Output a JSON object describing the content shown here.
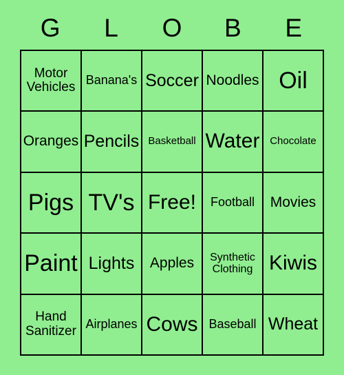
{
  "card": {
    "title": "GLOBE",
    "header_letters": [
      "G",
      "L",
      "O",
      "B",
      "E"
    ],
    "colors": {
      "background": "#90ee90",
      "cell_background": "#90ee90",
      "border": "#000000",
      "text": "#000000"
    },
    "free_space": "Free!",
    "rows": [
      [
        {
          "label": "Motor\nVehicles",
          "size": "fs-2line-md"
        },
        {
          "label": "Banana's",
          "size": "fs-sm"
        },
        {
          "label": "Soccer",
          "size": "fs-lg"
        },
        {
          "label": "Noodles",
          "size": "fs-md"
        },
        {
          "label": "Oil",
          "size": "fs-xxl"
        }
      ],
      [
        {
          "label": "Oranges",
          "size": "fs-md"
        },
        {
          "label": "Pencils",
          "size": "fs-lg"
        },
        {
          "label": "Basketball",
          "size": "fs-xs"
        },
        {
          "label": "Water",
          "size": "fs-xl"
        },
        {
          "label": "Chocolate",
          "size": "fs-xs"
        }
      ],
      [
        {
          "label": "Pigs",
          "size": "fs-xxl"
        },
        {
          "label": "TV's",
          "size": "fs-xxl"
        },
        {
          "label": "Free!",
          "size": "fs-xl"
        },
        {
          "label": "Football",
          "size": "fs-sm"
        },
        {
          "label": "Movies",
          "size": "fs-md"
        }
      ],
      [
        {
          "label": "Paint",
          "size": "fs-xxl"
        },
        {
          "label": "Lights",
          "size": "fs-lg"
        },
        {
          "label": "Apples",
          "size": "fs-md"
        },
        {
          "label": "Synthetic\nClothing",
          "size": "fs-2line-sm"
        },
        {
          "label": "Kiwis",
          "size": "fs-xl"
        }
      ],
      [
        {
          "label": "Hand\nSanitizer",
          "size": "fs-2line-md"
        },
        {
          "label": "Airplanes",
          "size": "fs-sm"
        },
        {
          "label": "Cows",
          "size": "fs-xl"
        },
        {
          "label": "Baseball",
          "size": "fs-sm"
        },
        {
          "label": "Wheat",
          "size": "fs-lg"
        }
      ]
    ]
  }
}
